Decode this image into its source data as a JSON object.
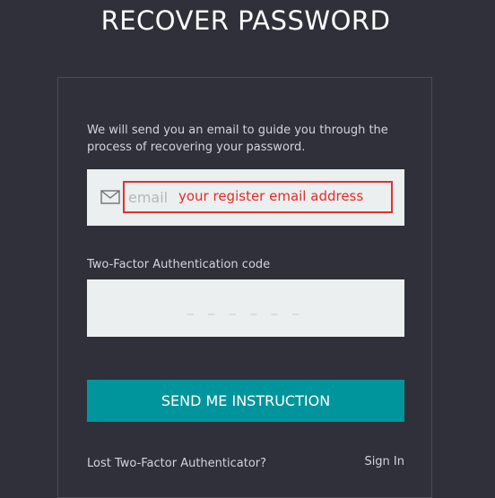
{
  "page": {
    "title": "RECOVER PASSWORD"
  },
  "form": {
    "intro": "We will send you an email to guide you through the process of recovering your password.",
    "email": {
      "placeholder": "email",
      "value": "",
      "icon": "envelope-icon"
    },
    "annotation": {
      "text": "your register email address",
      "color": "#e03131"
    },
    "two_factor": {
      "label": "Two-Factor Authentication code",
      "placeholder": "_ _ _ _ _ _",
      "value": ""
    },
    "submit_label": "SEND ME INSTRUCTION"
  },
  "footer": {
    "lost_authenticator": "Lost Two-Factor Authenticator?",
    "sign_in": "Sign In"
  },
  "colors": {
    "background": "#2f303a",
    "accent": "#00959c",
    "input_bg": "#ebefef"
  }
}
